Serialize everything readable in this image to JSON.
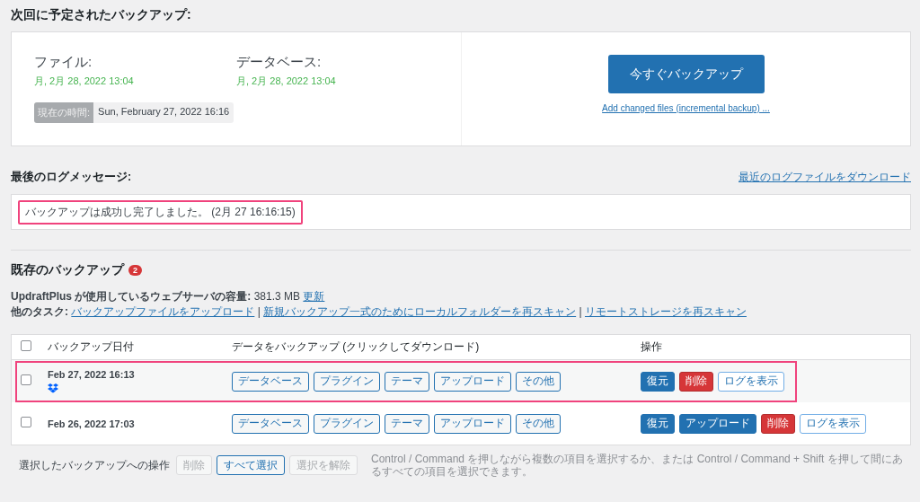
{
  "schedule": {
    "heading": "次回に予定されたバックアップ:",
    "items": [
      {
        "label": "ファイル:",
        "value": "月, 2月 28, 2022 13:04"
      },
      {
        "label": "データベース:",
        "value": "月, 2月 28, 2022 13:04"
      }
    ],
    "current_time_label": "現在の時間:",
    "current_time": "Sun, February 27, 2022 16:16",
    "backup_button": "今すぐバックアップ",
    "incremental_link": "Add changed files (incremental backup) ..."
  },
  "log": {
    "heading": "最後のログメッセージ:",
    "download_link": "最近のログファイルをダウンロード",
    "message": "バックアップは成功し完了しました。 (2月 27 16:16:15)",
    "highlighted": true
  },
  "existing": {
    "heading": "既存のバックアップ",
    "count": "2",
    "usage_label": "UpdraftPlus が使用しているウェブサーバの容量:",
    "usage_value": "381.3 MB",
    "refresh_link": "更新",
    "tasks_label": "他のタスク:",
    "task_separator": "|",
    "tasks": [
      "バックアップファイルをアップロード",
      "新規バックアップ一式のためにローカルフォルダーを再スキャン",
      "リモートストレージを再スキャン"
    ]
  },
  "table": {
    "select_all_checked": false,
    "columns": [
      "バックアップ日付",
      "データをバックアップ (クリックしてダウンロード)",
      "操作"
    ],
    "rows": [
      {
        "checked": false,
        "highlighted": true,
        "remote_stored": true,
        "date": "Feb 27, 2022 16:13",
        "data": [
          "データベース",
          "プラグイン",
          "テーマ",
          "アップロード",
          "その他"
        ],
        "actions": [
          {
            "label": "復元",
            "kind": "primary"
          },
          {
            "label": "削除",
            "kind": "danger"
          },
          {
            "label": "ログを表示",
            "kind": "outline"
          }
        ]
      },
      {
        "checked": false,
        "highlighted": false,
        "remote_stored": false,
        "date": "Feb 26, 2022 17:03",
        "data": [
          "データベース",
          "プラグイン",
          "テーマ",
          "アップロード",
          "その他"
        ],
        "actions": [
          {
            "label": "復元",
            "kind": "primary"
          },
          {
            "label": "アップロード",
            "kind": "primary"
          },
          {
            "label": "削除",
            "kind": "danger"
          },
          {
            "label": "ログを表示",
            "kind": "outline"
          }
        ]
      }
    ]
  },
  "bulk": {
    "label": "選択したバックアップへの操作",
    "buttons": [
      {
        "label": "削除",
        "disabled": true
      },
      {
        "label": "すべて選択",
        "disabled": false
      },
      {
        "label": "選択を解除",
        "disabled": true
      }
    ],
    "hint": "Control / Command を押しながら複数の項目を選択するか、または Control / Command + Shift を押して間にあるすべての項目を選択できます。"
  }
}
